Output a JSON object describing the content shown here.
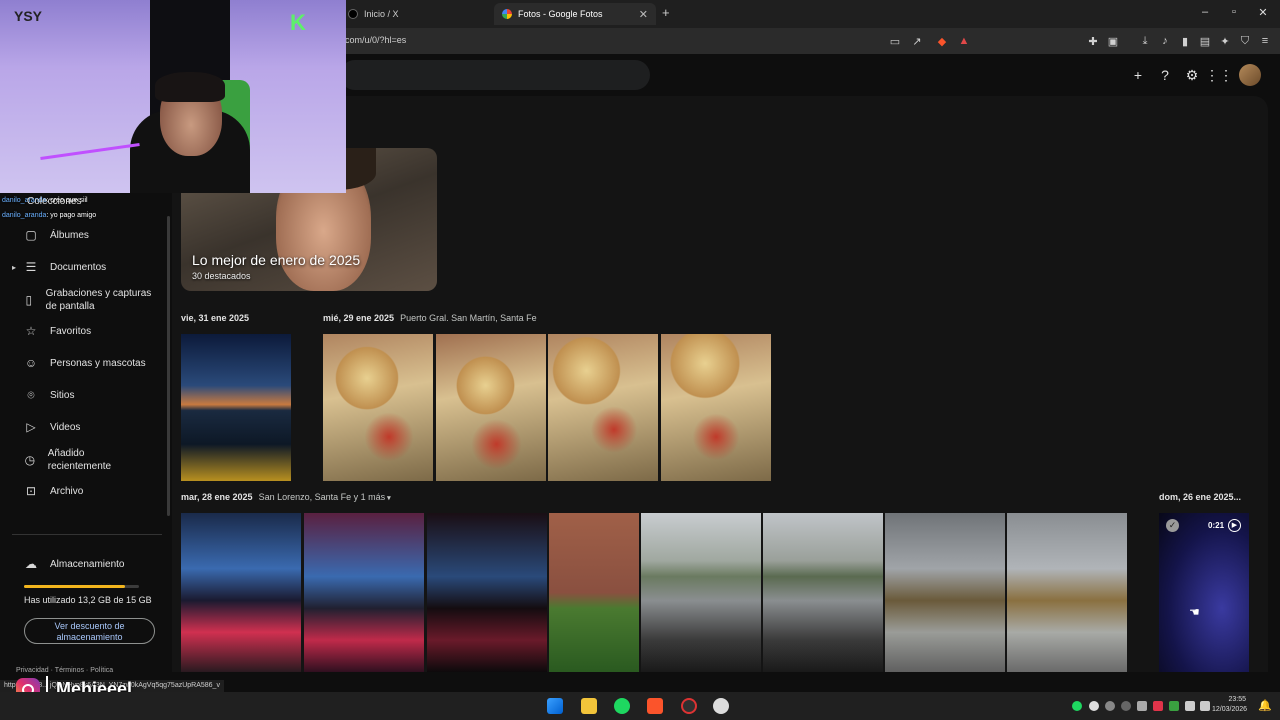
{
  "browser": {
    "tabs": [
      {
        "label": "Inicio / X",
        "active": false
      },
      {
        "label": "Fotos - Google Fotos",
        "active": true
      }
    ],
    "new_tab": "+",
    "url": "com/u/0/?hl=es",
    "win_controls": [
      "–",
      "▫",
      "✕"
    ]
  },
  "sidebar": {
    "items": [
      {
        "label": "Álbumes",
        "icon": "album-icon"
      },
      {
        "label": "Documentos",
        "icon": "document-icon"
      },
      {
        "label": "Grabaciones y capturas de pantalla",
        "icon": "screenshot-icon"
      },
      {
        "label": "Favoritos",
        "icon": "star-icon"
      },
      {
        "label": "Personas y mascotas",
        "icon": "face-icon"
      },
      {
        "label": "Sitios",
        "icon": "location-icon"
      },
      {
        "label": "Videos",
        "icon": "play-icon"
      },
      {
        "label": "Añadido recientemente",
        "icon": "clock-icon"
      },
      {
        "label": "Archivo",
        "icon": "archive-icon"
      }
    ],
    "storage_label": "Almacenamiento",
    "storage_used_text": "Has utilizado 13,2 GB de 15 GB",
    "storage_fraction": 0.88,
    "storage_button": "Ver descuento de almacenamiento",
    "footer_links": [
      "Privacidad",
      "Términos",
      "Política"
    ]
  },
  "main": {
    "highlight": {
      "title": "Lo mejor de enero de 2025",
      "subtitle": "30 destacados"
    },
    "groups": [
      {
        "date": "vie, 31 ene 2025",
        "location": ""
      },
      {
        "date": "mié, 29 ene 2025",
        "location": "Puerto Gral. San Martín, Santa Fe"
      },
      {
        "date": "mar, 28 ene 2025",
        "location": "San Lorenzo, Santa Fe y 1 más"
      },
      {
        "date": "dom, 26 ene 2025...",
        "location": ""
      }
    ],
    "video_duration": "0:21"
  },
  "overlay": {
    "chat": [
      {
        "user": "danilo_aranda",
        "msg": ": creo que siil"
      },
      {
        "user": "danilo_aranda",
        "msg": ": yo pago amigo"
      }
    ],
    "chat_header": "Colecciones",
    "instagram_handle": "Mehieeel",
    "status_url": "https://...ps8... jQipNHyp8k6A3N_YN7zw0kAgVq5qg75azUpRA586_v"
  },
  "taskbar": {
    "time": "23:55",
    "date": "12/03/2026"
  }
}
